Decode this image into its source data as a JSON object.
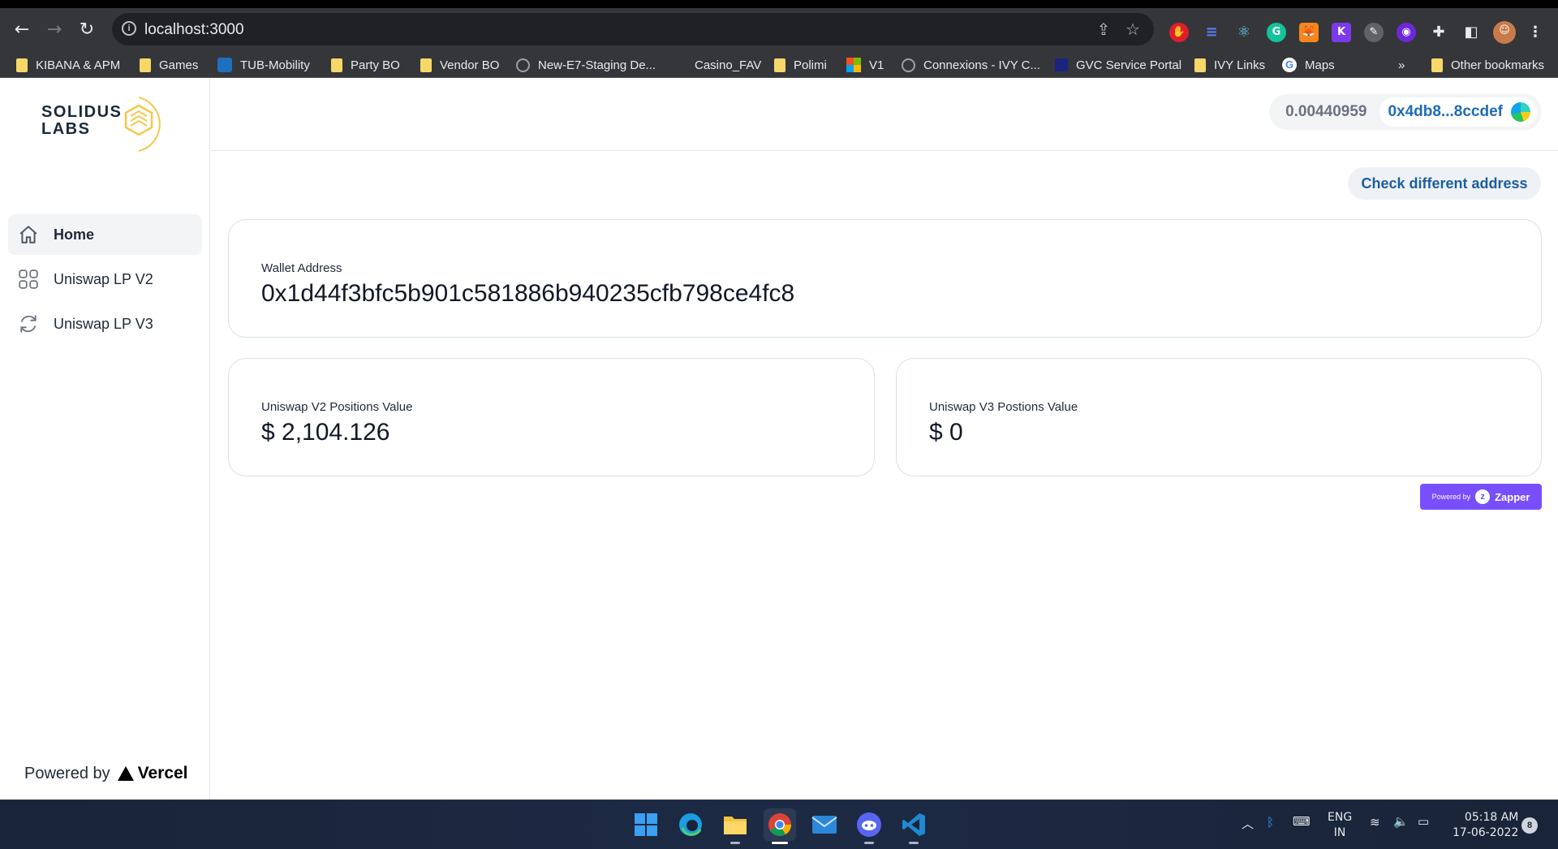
{
  "browser": {
    "url": "localhost:3000",
    "bookmarks": [
      {
        "label": "KIBANA & APM",
        "icon": "folder-icon"
      },
      {
        "label": "Games",
        "icon": "folder-icon"
      },
      {
        "label": "TUB-Mobility",
        "icon": "tub-icon"
      },
      {
        "label": "Party BO",
        "icon": "folder-icon"
      },
      {
        "label": "Vendor BO",
        "icon": "folder-icon"
      },
      {
        "label": "New-E7-Staging De...",
        "icon": "globe-icon"
      },
      {
        "label": "Casino_FAV",
        "icon": "none"
      },
      {
        "label": "Polimi",
        "icon": "folder-icon"
      },
      {
        "label": "V1",
        "icon": "microsoft-icon"
      },
      {
        "label": "Connexions - IVY C...",
        "icon": "globe-icon"
      },
      {
        "label": "GVC Service Portal",
        "icon": "gvc-icon"
      },
      {
        "label": "IVY Links",
        "icon": "folder-icon"
      },
      {
        "label": "Maps",
        "icon": "google-icon"
      }
    ],
    "overflow_label": "»",
    "other_bookmarks": "Other bookmarks"
  },
  "sidebar": {
    "logo_line1": "SOLIDUS",
    "logo_line2": "LABS",
    "items": [
      {
        "label": "Home",
        "icon": "home-icon",
        "active": true
      },
      {
        "label": "Uniswap LP V2",
        "icon": "grid-icon",
        "active": false
      },
      {
        "label": "Uniswap LP V3",
        "icon": "refresh-icon",
        "active": false
      }
    ],
    "powered_by": "Powered by",
    "powered_brand": "Vercel"
  },
  "header": {
    "balance": "0.00440959",
    "address": "0x4db8...8ccdef"
  },
  "main": {
    "check_button": "Check different address",
    "wallet_card": {
      "label": "Wallet Address",
      "value": "0x1d44f3bfc5b901c581886b940235cfb798ce4fc8"
    },
    "v2_card": {
      "label": "Uniswap V2 Positions Value",
      "value": "$ 2,104.126"
    },
    "v3_card": {
      "label": "Uniswap V3 Postions Value",
      "value": "$ 0"
    },
    "zapper": {
      "prefix": "Powered by",
      "brand": "Zapper"
    }
  },
  "taskbar": {
    "lang_top": "ENG",
    "lang_bottom": "IN",
    "time": "05:18 AM",
    "date": "17-06-2022",
    "notifications": "8"
  },
  "colors": {
    "accent_blue": "#1e6bb8",
    "zapper_purple": "#784ffe",
    "logo_gold": "#f2c94c"
  }
}
